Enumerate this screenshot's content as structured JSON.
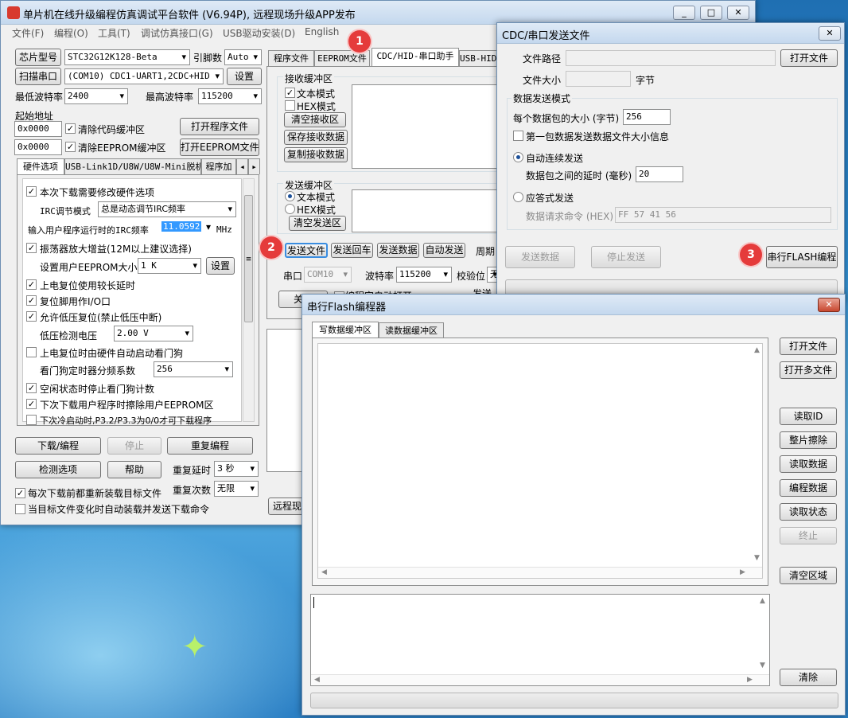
{
  "main": {
    "title": "单片机在线升级编程仿真调试平台软件 (V6.94P), 远程现场升级APP发布",
    "menu": [
      "文件(F)",
      "编程(O)",
      "工具(T)",
      "调试仿真接口(G)",
      "USB驱动安装(D)",
      "English"
    ],
    "chip_label": "芯片型号",
    "chip_value": "STC32G12K128-Beta",
    "pins_label": "引脚数",
    "pins_value": "Auto",
    "scan_label": "扫描串口",
    "port_value": "(COM10) CDC1-UART1,2CDC+HID",
    "settings_label": "设置",
    "min_baud_label": "最低波特率",
    "min_baud_value": "2400",
    "max_baud_label": "最高波特率",
    "max_baud_value": "115200",
    "start_addr_label": "起始地址",
    "addr1": "0x0000",
    "clear_code_label": "清除代码缓冲区",
    "open_prog_label": "打开程序文件",
    "addr2": "0x0000",
    "clear_eeprom_label": "清除EEPROM缓冲区",
    "open_eeprom_label": "打开EEPROM文件",
    "left_tabs": [
      "硬件选项",
      "USB-Link1D/U8W/U8W-Mini脱机",
      "程序加"
    ],
    "hw": {
      "opt_modify": "本次下载需要修改硬件选项",
      "irc_mode_label": "IRC调节模式",
      "irc_mode_value": "总是动态调节IRC频率",
      "freq_label": "输入用户程序运行时的IRC频率",
      "freq_value": "11.0592",
      "freq_unit": "MHz",
      "osc_gain": "振荡器放大增益(12M以上建议选择)",
      "eeprom_size_label": "设置用户EEPROM大小",
      "eeprom_size_value": "1  K",
      "eeprom_set": "设置",
      "long_delay": "上电复位使用较长延时",
      "reset_io": "复位脚用作I/O口",
      "lvr": "允许低压复位(禁止低压中断)",
      "lv_label": "低压检测电压",
      "lv_value": "2.00 V",
      "wdt_auto": "上电复位时由硬件自动启动看门狗",
      "wdt_div_label": "看门狗定时器分频系数",
      "wdt_div_value": "256",
      "idle_wdt": "空闲状态时停止看门狗计数",
      "erase_eeprom": "下次下载用户程序时擦除用户EEPROM区",
      "cold_boot": "下次冷启动时,P3.2/P3.3为0/0才可下载程序"
    },
    "download_label": "下载/编程",
    "stop_label": "停止",
    "reprogram_label": "重复编程",
    "detect_label": "检测选项",
    "help_label": "帮助",
    "repeat_delay_label": "重复延时",
    "repeat_delay_value": "3 秒",
    "repeat_count_label": "重复次数",
    "repeat_count_value": "无限",
    "reload_label": "每次下载前都重新装载目标文件",
    "autoload_label": "当目标文件变化时自动装载并发送下载命令",
    "right_tabs": [
      "程序文件",
      "EEPROM文件",
      "CDC/HID-串口助手",
      "USB-HID"
    ],
    "recv_buffer_label": "接收缓冲区",
    "text_mode": "文本模式",
    "hex_mode": "HEX模式",
    "clear_recv": "清空接收区",
    "save_recv": "保存接收数据",
    "copy_recv": "复制接收数据",
    "send_buffer_label": "发送缓冲区",
    "clear_send": "清空发送区",
    "send_file": "发送文件",
    "send_return": "发送回车",
    "send_data": "发送数据",
    "auto_send": "自动发送",
    "period_label": "周期",
    "port_label": "串口",
    "port2_value": "COM10",
    "baud_label": "波特率",
    "baud_value": "115200",
    "parity_label": "校验位",
    "parity_value": "无",
    "close_label": "关闭",
    "auto_open_label": "编程完自动打开",
    "send_label2": "发送",
    "remote_label": "远程现"
  },
  "cdc": {
    "title": "CDC/串口发送文件",
    "path_label": "文件路径",
    "open_file": "打开文件",
    "size_label": "文件大小",
    "size_unit": "字节",
    "mode_group": "数据发送模式",
    "packet_size_label": "每个数据包的大小 (字节)",
    "packet_size_value": "256",
    "first_packet_label": "第一包数据发送数据文件大小信息",
    "auto_send_label": "自动连续发送",
    "delay_label": "数据包之间的延时 (毫秒)",
    "delay_value": "20",
    "ack_label": "应答式发送",
    "request_label": "数据请求命令 (HEX)",
    "request_value": "FF 57 41 56",
    "send_data": "发送数据",
    "stop_send": "停止发送",
    "flash_prog": "串行FLASH编程"
  },
  "flash": {
    "title": "串行Flash编程器",
    "tabs": [
      "写数据缓冲区",
      "读数据缓冲区"
    ],
    "open_file": "打开文件",
    "open_multi": "打开多文件",
    "read_id": "读取ID",
    "chip_erase": "整片擦除",
    "read_data": "读取数据",
    "prog_data": "编程数据",
    "read_status": "读取状态",
    "terminate": "终止",
    "clear_area": "清空区域",
    "clear": "清除"
  },
  "badges": [
    "1",
    "2",
    "3"
  ]
}
